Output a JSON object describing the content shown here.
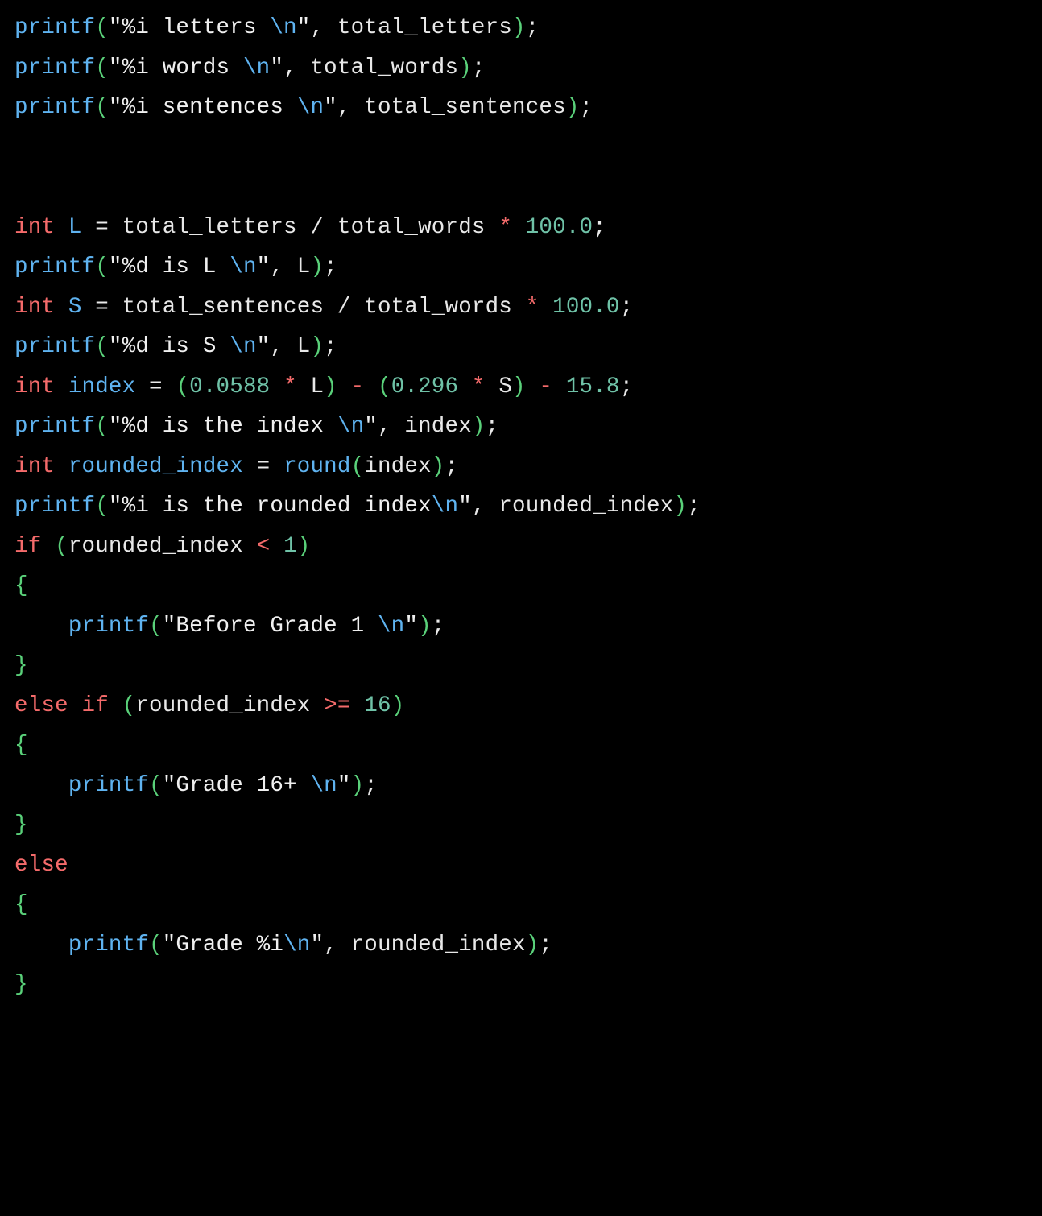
{
  "code": {
    "lines": [
      {
        "indent": 0,
        "tokens": [
          {
            "t": "printf",
            "c": "fn"
          },
          {
            "t": "(",
            "c": "par"
          },
          {
            "t": "\"%i letters ",
            "c": "str"
          },
          {
            "t": "\\n",
            "c": "esc"
          },
          {
            "t": "\"",
            "c": "str"
          },
          {
            "t": ", ",
            "c": "pun"
          },
          {
            "t": "total_letters",
            "c": "var"
          },
          {
            "t": ")",
            "c": "par"
          },
          {
            "t": ";",
            "c": "pun"
          }
        ]
      },
      {
        "indent": 0,
        "tokens": [
          {
            "t": "printf",
            "c": "fn"
          },
          {
            "t": "(",
            "c": "par"
          },
          {
            "t": "\"%i words ",
            "c": "str"
          },
          {
            "t": "\\n",
            "c": "esc"
          },
          {
            "t": "\"",
            "c": "str"
          },
          {
            "t": ", ",
            "c": "pun"
          },
          {
            "t": "total_words",
            "c": "var"
          },
          {
            "t": ")",
            "c": "par"
          },
          {
            "t": ";",
            "c": "pun"
          }
        ]
      },
      {
        "indent": 0,
        "tokens": [
          {
            "t": "printf",
            "c": "fn"
          },
          {
            "t": "(",
            "c": "par"
          },
          {
            "t": "\"%i sentences ",
            "c": "str"
          },
          {
            "t": "\\n",
            "c": "esc"
          },
          {
            "t": "\"",
            "c": "str"
          },
          {
            "t": ", ",
            "c": "pun"
          },
          {
            "t": "total_sentences",
            "c": "var"
          },
          {
            "t": ")",
            "c": "par"
          },
          {
            "t": ";",
            "c": "pun"
          }
        ]
      },
      {
        "indent": 0,
        "tokens": []
      },
      {
        "indent": 0,
        "tokens": []
      },
      {
        "indent": 0,
        "tokens": [
          {
            "t": "int",
            "c": "kw"
          },
          {
            "t": " ",
            "c": "op"
          },
          {
            "t": "L",
            "c": "decl"
          },
          {
            "t": " = ",
            "c": "op"
          },
          {
            "t": "total_letters",
            "c": "var"
          },
          {
            "t": " / ",
            "c": "div"
          },
          {
            "t": "total_words",
            "c": "var"
          },
          {
            "t": " ",
            "c": "op"
          },
          {
            "t": "*",
            "c": "mul"
          },
          {
            "t": " ",
            "c": "op"
          },
          {
            "t": "100.0",
            "c": "num"
          },
          {
            "t": ";",
            "c": "pun"
          }
        ]
      },
      {
        "indent": 0,
        "tokens": [
          {
            "t": "printf",
            "c": "fn"
          },
          {
            "t": "(",
            "c": "par"
          },
          {
            "t": "\"%d is L ",
            "c": "str"
          },
          {
            "t": "\\n",
            "c": "esc"
          },
          {
            "t": "\"",
            "c": "str"
          },
          {
            "t": ", ",
            "c": "pun"
          },
          {
            "t": "L",
            "c": "var"
          },
          {
            "t": ")",
            "c": "par"
          },
          {
            "t": ";",
            "c": "pun"
          }
        ]
      },
      {
        "indent": 0,
        "tokens": [
          {
            "t": "int",
            "c": "kw"
          },
          {
            "t": " ",
            "c": "op"
          },
          {
            "t": "S",
            "c": "decl"
          },
          {
            "t": " = ",
            "c": "op"
          },
          {
            "t": "total_sentences",
            "c": "var"
          },
          {
            "t": " / ",
            "c": "div"
          },
          {
            "t": "total_words",
            "c": "var"
          },
          {
            "t": " ",
            "c": "op"
          },
          {
            "t": "*",
            "c": "mul"
          },
          {
            "t": " ",
            "c": "op"
          },
          {
            "t": "100.0",
            "c": "num"
          },
          {
            "t": ";",
            "c": "pun"
          }
        ]
      },
      {
        "indent": 0,
        "tokens": [
          {
            "t": "printf",
            "c": "fn"
          },
          {
            "t": "(",
            "c": "par"
          },
          {
            "t": "\"%d is S ",
            "c": "str"
          },
          {
            "t": "\\n",
            "c": "esc"
          },
          {
            "t": "\"",
            "c": "str"
          },
          {
            "t": ", ",
            "c": "pun"
          },
          {
            "t": "L",
            "c": "var"
          },
          {
            "t": ")",
            "c": "par"
          },
          {
            "t": ";",
            "c": "pun"
          }
        ]
      },
      {
        "indent": 0,
        "tokens": [
          {
            "t": "int",
            "c": "kw"
          },
          {
            "t": " ",
            "c": "op"
          },
          {
            "t": "index",
            "c": "decl"
          },
          {
            "t": " = ",
            "c": "op"
          },
          {
            "t": "(",
            "c": "par"
          },
          {
            "t": "0.0588",
            "c": "num"
          },
          {
            "t": " ",
            "c": "op"
          },
          {
            "t": "*",
            "c": "mul"
          },
          {
            "t": " ",
            "c": "op"
          },
          {
            "t": "L",
            "c": "var"
          },
          {
            "t": ")",
            "c": "par"
          },
          {
            "t": " ",
            "c": "op"
          },
          {
            "t": "-",
            "c": "min"
          },
          {
            "t": " ",
            "c": "op"
          },
          {
            "t": "(",
            "c": "par"
          },
          {
            "t": "0.296",
            "c": "num"
          },
          {
            "t": " ",
            "c": "op"
          },
          {
            "t": "*",
            "c": "mul"
          },
          {
            "t": " ",
            "c": "op"
          },
          {
            "t": "S",
            "c": "var"
          },
          {
            "t": ")",
            "c": "par"
          },
          {
            "t": " ",
            "c": "op"
          },
          {
            "t": "-",
            "c": "min"
          },
          {
            "t": " ",
            "c": "op"
          },
          {
            "t": "15.8",
            "c": "num"
          },
          {
            "t": ";",
            "c": "pun"
          }
        ]
      },
      {
        "indent": 0,
        "tokens": [
          {
            "t": "printf",
            "c": "fn"
          },
          {
            "t": "(",
            "c": "par"
          },
          {
            "t": "\"%d is the index ",
            "c": "str"
          },
          {
            "t": "\\n",
            "c": "esc"
          },
          {
            "t": "\"",
            "c": "str"
          },
          {
            "t": ", ",
            "c": "pun"
          },
          {
            "t": "index",
            "c": "var"
          },
          {
            "t": ")",
            "c": "par"
          },
          {
            "t": ";",
            "c": "pun"
          }
        ]
      },
      {
        "indent": 0,
        "tokens": [
          {
            "t": "int",
            "c": "kw"
          },
          {
            "t": " ",
            "c": "op"
          },
          {
            "t": "rounded_index",
            "c": "decl"
          },
          {
            "t": " = ",
            "c": "op"
          },
          {
            "t": "round",
            "c": "fn"
          },
          {
            "t": "(",
            "c": "par"
          },
          {
            "t": "index",
            "c": "var"
          },
          {
            "t": ")",
            "c": "par"
          },
          {
            "t": ";",
            "c": "pun"
          }
        ]
      },
      {
        "indent": 0,
        "tokens": [
          {
            "t": "printf",
            "c": "fn"
          },
          {
            "t": "(",
            "c": "par"
          },
          {
            "t": "\"%i is the rounded index",
            "c": "str"
          },
          {
            "t": "\\n",
            "c": "esc"
          },
          {
            "t": "\"",
            "c": "str"
          },
          {
            "t": ", ",
            "c": "pun"
          },
          {
            "t": "rounded_index",
            "c": "var"
          },
          {
            "t": ")",
            "c": "par"
          },
          {
            "t": ";",
            "c": "pun"
          }
        ]
      },
      {
        "indent": 0,
        "tokens": [
          {
            "t": "if",
            "c": "kw"
          },
          {
            "t": " ",
            "c": "op"
          },
          {
            "t": "(",
            "c": "par"
          },
          {
            "t": "rounded_index",
            "c": "var"
          },
          {
            "t": " ",
            "c": "op"
          },
          {
            "t": "<",
            "c": "cmp"
          },
          {
            "t": " ",
            "c": "op"
          },
          {
            "t": "1",
            "c": "num"
          },
          {
            "t": ")",
            "c": "par"
          }
        ]
      },
      {
        "indent": 0,
        "tokens": [
          {
            "t": "{",
            "c": "brc"
          }
        ]
      },
      {
        "indent": 1,
        "tokens": [
          {
            "t": "printf",
            "c": "fn"
          },
          {
            "t": "(",
            "c": "par"
          },
          {
            "t": "\"Before Grade 1 ",
            "c": "str"
          },
          {
            "t": "\\n",
            "c": "esc"
          },
          {
            "t": "\"",
            "c": "str"
          },
          {
            "t": ")",
            "c": "par"
          },
          {
            "t": ";",
            "c": "pun"
          }
        ]
      },
      {
        "indent": 0,
        "tokens": [
          {
            "t": "}",
            "c": "brc"
          }
        ]
      },
      {
        "indent": 0,
        "tokens": [
          {
            "t": "else",
            "c": "kw"
          },
          {
            "t": " ",
            "c": "op"
          },
          {
            "t": "if",
            "c": "kw"
          },
          {
            "t": " ",
            "c": "op"
          },
          {
            "t": "(",
            "c": "par"
          },
          {
            "t": "rounded_index",
            "c": "var"
          },
          {
            "t": " ",
            "c": "op"
          },
          {
            "t": ">=",
            "c": "cmp"
          },
          {
            "t": " ",
            "c": "op"
          },
          {
            "t": "16",
            "c": "num"
          },
          {
            "t": ")",
            "c": "par"
          }
        ]
      },
      {
        "indent": 0,
        "tokens": [
          {
            "t": "{",
            "c": "brc"
          }
        ]
      },
      {
        "indent": 1,
        "tokens": [
          {
            "t": "printf",
            "c": "fn"
          },
          {
            "t": "(",
            "c": "par"
          },
          {
            "t": "\"Grade 16+ ",
            "c": "str"
          },
          {
            "t": "\\n",
            "c": "esc"
          },
          {
            "t": "\"",
            "c": "str"
          },
          {
            "t": ")",
            "c": "par"
          },
          {
            "t": ";",
            "c": "pun"
          }
        ]
      },
      {
        "indent": 0,
        "tokens": [
          {
            "t": "}",
            "c": "brc"
          }
        ]
      },
      {
        "indent": 0,
        "tokens": [
          {
            "t": "else",
            "c": "kw"
          }
        ]
      },
      {
        "indent": 0,
        "tokens": [
          {
            "t": "{",
            "c": "brc"
          }
        ]
      },
      {
        "indent": 1,
        "tokens": [
          {
            "t": "printf",
            "c": "fn"
          },
          {
            "t": "(",
            "c": "par"
          },
          {
            "t": "\"Grade %i",
            "c": "str"
          },
          {
            "t": "\\n",
            "c": "esc"
          },
          {
            "t": "\"",
            "c": "str"
          },
          {
            "t": ", ",
            "c": "pun"
          },
          {
            "t": "rounded_index",
            "c": "var"
          },
          {
            "t": ")",
            "c": "par"
          },
          {
            "t": ";",
            "c": "pun"
          }
        ]
      },
      {
        "indent": 0,
        "tokens": [
          {
            "t": "}",
            "c": "brc"
          }
        ]
      }
    ],
    "indent_unit": "    "
  }
}
